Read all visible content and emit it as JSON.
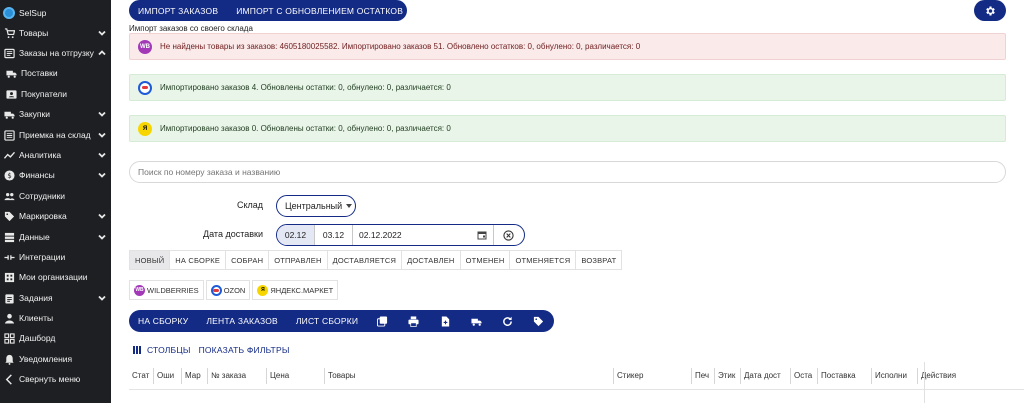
{
  "sidebar": {
    "brand": "SelSup",
    "items": [
      {
        "label": "Товары",
        "icon": "cart-icon",
        "chevron": true
      },
      {
        "label": "Заказы на отгрузку",
        "icon": "box-icon",
        "chevron": true
      },
      {
        "label": "Поставки",
        "icon": "truck-icon",
        "chevron": false
      },
      {
        "label": "Покупатели",
        "icon": "contacts-icon",
        "chevron": false
      },
      {
        "label": "Закупки",
        "icon": "transport-icon",
        "chevron": true
      },
      {
        "label": "Приемка на склад",
        "icon": "list-icon",
        "chevron": true
      },
      {
        "label": "Аналитика",
        "icon": "chart-icon",
        "chevron": true
      },
      {
        "label": "Финансы",
        "icon": "dollar-icon",
        "chevron": true
      },
      {
        "label": "Сотрудники",
        "icon": "people-icon",
        "chevron": false
      },
      {
        "label": "Маркировка",
        "icon": "tag-icon",
        "chevron": true
      },
      {
        "label": "Данные",
        "icon": "database-icon",
        "chevron": true
      },
      {
        "label": "Интеграции",
        "icon": "integration-icon",
        "chevron": false
      },
      {
        "label": "Мои организации",
        "icon": "organization-icon",
        "chevron": false
      },
      {
        "label": "Задания",
        "icon": "clipboard-icon",
        "chevron": true
      },
      {
        "label": "Клиенты",
        "icon": "person-icon",
        "chevron": false
      },
      {
        "label": "Дашборд",
        "icon": "dashboard-icon",
        "chevron": false
      },
      {
        "label": "Уведомления",
        "icon": "bell-icon",
        "chevron": false
      },
      {
        "label": "Свернуть меню",
        "icon": "chevron-left-icon",
        "chevron": false
      }
    ]
  },
  "toolbar": {
    "import_orders": "ИМПОРТ ЗАКАЗОВ",
    "import_with_stock": "ИМПОРТ С ОБНОВЛЕНИЕМ ОСТАТКОВ"
  },
  "section_title": "Импорт заказов со своего склада",
  "alerts": [
    {
      "marketplace": "wildberries",
      "badge": "WB",
      "type": "error",
      "text": "Не найдены товары из заказов: 4605180025582. Импортировано заказов 51. Обновлено остатков: 0, обнулено: 0, различается: 0"
    },
    {
      "marketplace": "ozon",
      "badge": "",
      "type": "success",
      "text": "Импортировано заказов 4. Обновлены остатки: 0, обнулено: 0, различается: 0"
    },
    {
      "marketplace": "yandex",
      "badge": "Я",
      "type": "success",
      "text": "Импортировано заказов 0. Обновлены остатки: 0, обнулено: 0, различается: 0"
    }
  ],
  "search": {
    "placeholder": "Поиск по номеру заказа и названию"
  },
  "filters": {
    "warehouse_label": "Склад",
    "warehouse_value": "Центральный",
    "delivery_label": "Дата доставки",
    "date_chip_1": "02.12",
    "date_chip_2": "03.12",
    "date_value": "02.12.2022"
  },
  "status_tabs": [
    "НОВЫЙ",
    "НА СБОРКЕ",
    "СОБРАН",
    "ОТПРАВЛЕН",
    "ДОСТАВЛЯЕТСЯ",
    "ДОСТАВЛЕН",
    "ОТМЕНЕН",
    "ОТМЕНЯЕТСЯ",
    "ВОЗВРАТ"
  ],
  "marketplace_tabs": [
    {
      "label": "WILDBERRIES",
      "badge": "WB"
    },
    {
      "label": "OZON",
      "badge": ""
    },
    {
      "label": "ЯНДЕКС.МАРКЕТ",
      "badge": "Я"
    }
  ],
  "actions": {
    "to_assembly": "НА СБОРКУ",
    "orders_feed": "ЛЕНТА ЗАКАЗОВ",
    "assembly_sheet": "ЛИСТ СБОРКИ"
  },
  "columns_bar": {
    "columns": "СТОЛБЦЫ",
    "show_filters": "ПОКАЗАТЬ ФИЛЬТРЫ"
  },
  "table": {
    "headers": [
      "Стат",
      "Оши",
      "Мар",
      "№ заказа",
      "Цена",
      "Товары",
      "Стикер",
      "Печ",
      "Этик",
      "Дата дост",
      "Оста",
      "Поставка",
      "Исполни",
      "Действия"
    ]
  },
  "colors": {
    "primary": "#142b86",
    "sidebar": "#1d1f22"
  }
}
